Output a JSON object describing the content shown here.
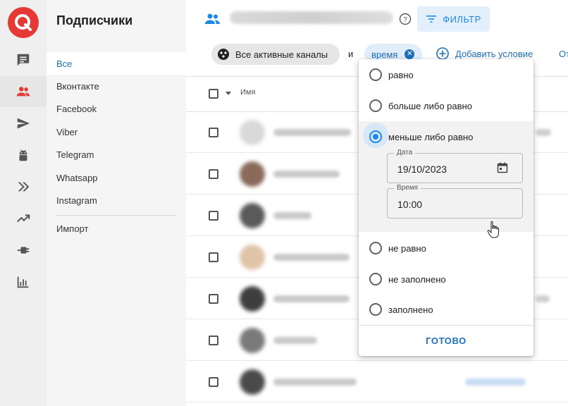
{
  "sidebar": {
    "title": "Подписчики",
    "items": [
      {
        "label": "Все",
        "active": true
      },
      {
        "label": "Вконтакте"
      },
      {
        "label": "Facebook"
      },
      {
        "label": "Viber"
      },
      {
        "label": "Telegram"
      },
      {
        "label": "Whatsapp"
      },
      {
        "label": "Instagram"
      }
    ],
    "import_label": "Импорт"
  },
  "rail": {
    "icons": [
      "chat-icon",
      "people-icon",
      "send-icon",
      "android-icon",
      "double-chevron-icon",
      "trending-up-icon",
      "plug-icon",
      "bar-chart-icon"
    ],
    "active": "people-icon"
  },
  "toolbar": {
    "filter_label": "ФИЛЬТР"
  },
  "filter_chips": {
    "channels_label": "Все активные каналы",
    "and_label": "и",
    "time_label": "время",
    "add_condition_label": "Добавить условие",
    "cut_label": "От"
  },
  "table": {
    "name_header": "Имя"
  },
  "dropdown": {
    "options": [
      "равно",
      "больше либо равно",
      "меньше либо равно",
      "не равно",
      "не заполнено",
      "заполнено"
    ],
    "selected_index": 2,
    "date_label": "Дата",
    "date_value": "19/10/2023",
    "time_label": "Время",
    "time_value": "10:00",
    "done_label": "ГОТОВО"
  },
  "colors": {
    "accent": "#1e88e5",
    "brand": "#e53935",
    "link": "#1e6fb8"
  }
}
